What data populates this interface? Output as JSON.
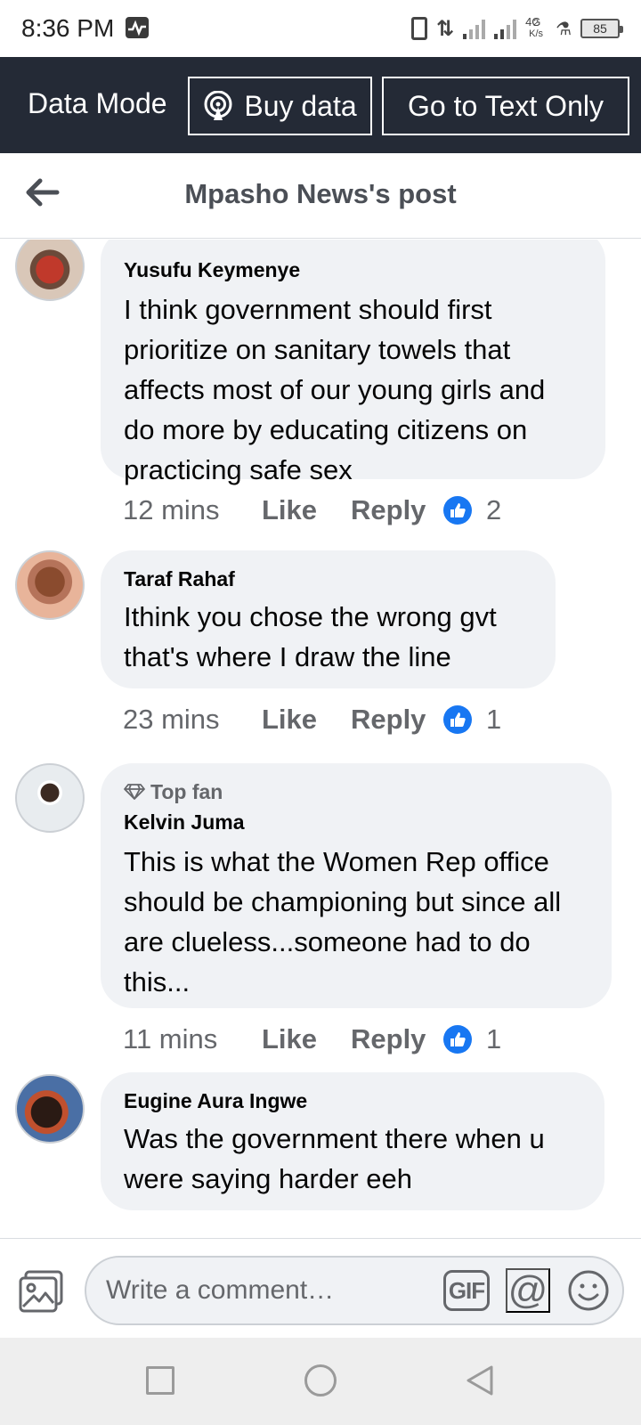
{
  "status_bar": {
    "time": "8:36 PM",
    "network_type": "4G",
    "speed_value": "2",
    "speed_unit": "K/s",
    "battery": "85"
  },
  "data_bar": {
    "mode_label": "Data Mode",
    "buy_label": "Buy data",
    "text_only_label": "Go to Text Only"
  },
  "header": {
    "title": "Mpasho News's post"
  },
  "comments": [
    {
      "name": "Yusufu Keymenye",
      "text": "I think government should first prioritize on sanitary towels that affects most of our young girls and do more by educating citizens on practicing safe sex",
      "time": "12 mins",
      "like_label": "Like",
      "reply_label": "Reply",
      "likes": "2"
    },
    {
      "name": "Taraf Rahaf",
      "text": "Ithink you chose the wrong gvt that's where I draw the line",
      "time": "23 mins",
      "like_label": "Like",
      "reply_label": "Reply",
      "likes": "1"
    },
    {
      "badge": "Top fan",
      "name": "Kelvin Juma",
      "text": "This is what the Women Rep office should  be championing but since all are clueless...someone had to do this...",
      "time": "11 mins",
      "like_label": "Like",
      "reply_label": "Reply",
      "likes": "1"
    },
    {
      "name": "Eugine Aura Ingwe",
      "text": "Was the government there when u were saying harder eeh"
    }
  ],
  "composer": {
    "placeholder": "Write a comment…",
    "gif_label": "GIF",
    "mention_label": "@"
  },
  "colors": {
    "data_bar_bg": "#242a36",
    "bubble_bg": "#f0f2f5",
    "like_blue": "#1877f2",
    "meta_gray": "#65676b"
  }
}
